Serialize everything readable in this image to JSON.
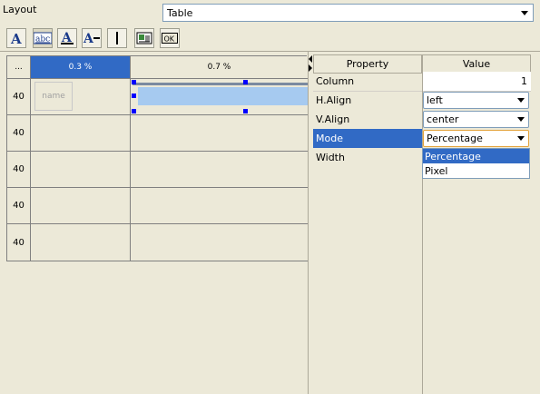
{
  "layout": {
    "label": "Layout",
    "selected": "Table"
  },
  "toolbar": {
    "buttons": [
      {
        "name": "text-format-icon"
      },
      {
        "name": "text-label-icon"
      },
      {
        "name": "text-underline-icon"
      },
      {
        "name": "text-strikethrough-icon"
      },
      {
        "name": "vertical-line-icon"
      },
      {
        "name": "image-icon"
      },
      {
        "name": "ok-button-icon"
      }
    ]
  },
  "grid": {
    "corner": "...",
    "columns": [
      "0.3 %",
      "0.7 %"
    ],
    "rows": [
      "40",
      "40",
      "40",
      "40",
      "40"
    ],
    "name_placeholder": "name"
  },
  "properties": {
    "header": {
      "property": "Property",
      "value": "Value"
    },
    "rows": [
      {
        "name": "Column",
        "value": "1"
      },
      {
        "name": "H.Align",
        "value": "left"
      },
      {
        "name": "V.Align",
        "value": "center"
      },
      {
        "name": "Mode",
        "value": "Percentage"
      },
      {
        "name": "Width",
        "value": ""
      }
    ],
    "mode_options": [
      "Percentage",
      "Pixel"
    ]
  },
  "colors": {
    "selection": "#316ac5",
    "background": "#ece9d8",
    "cell_fill": "#a6caf0"
  }
}
